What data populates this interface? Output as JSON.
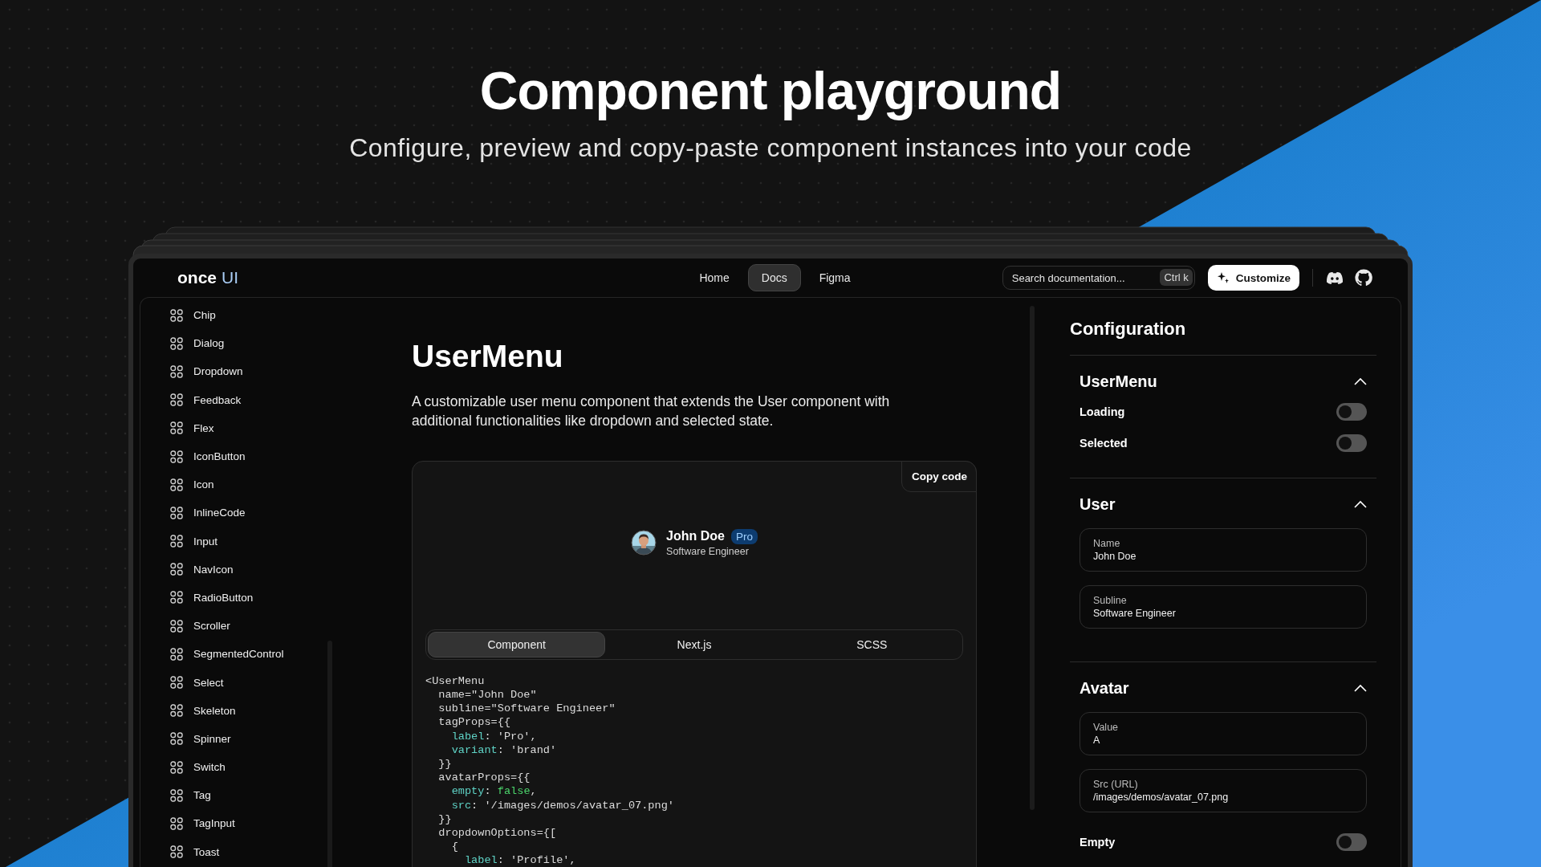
{
  "hero": {
    "title": "Component playground",
    "subtitle": "Configure, preview and copy-paste component instances into your code"
  },
  "header": {
    "logo": {
      "word": "once",
      "mark": "UI"
    },
    "nav": [
      {
        "label": "Home",
        "selected": false
      },
      {
        "label": "Docs",
        "selected": true
      },
      {
        "label": "Figma",
        "selected": false
      }
    ],
    "search": {
      "placeholder": "Search documentation...",
      "shortcut": "Ctrl k"
    },
    "customize_button": "Customize"
  },
  "sidebar": {
    "items": [
      "Chip",
      "Dialog",
      "Dropdown",
      "Feedback",
      "Flex",
      "IconButton",
      "Icon",
      "InlineCode",
      "Input",
      "NavIcon",
      "RadioButton",
      "Scroller",
      "SegmentedControl",
      "Select",
      "Skeleton",
      "Spinner",
      "Switch",
      "Tag",
      "TagInput",
      "Toast"
    ]
  },
  "page": {
    "title": "UserMenu",
    "description": "A customizable user menu component that extends the User component with additional functionalities like dropdown and selected state."
  },
  "preview": {
    "copy_button": "Copy code",
    "user": {
      "name": "John Doe",
      "tag": "Pro",
      "subline": "Software Engineer"
    },
    "tabs": [
      {
        "label": "Component",
        "selected": true
      },
      {
        "label": "Next.js",
        "selected": false
      },
      {
        "label": "SCSS",
        "selected": false
      }
    ],
    "code": [
      [
        {
          "kind": "plain",
          "text": "<UserMenu"
        }
      ],
      [
        {
          "kind": "plain",
          "text": "  name=\"John Doe\""
        }
      ],
      [
        {
          "kind": "plain",
          "text": "  subline=\"Software Engineer\""
        }
      ],
      [
        {
          "kind": "plain",
          "text": "  tagProps={{"
        }
      ],
      [
        {
          "kind": "key",
          "text": "    label"
        },
        {
          "kind": "plain",
          "text": ": 'Pro',"
        }
      ],
      [
        {
          "kind": "key",
          "text": "    variant"
        },
        {
          "kind": "plain",
          "text": ": 'brand'"
        }
      ],
      [
        {
          "kind": "plain",
          "text": "  }}"
        }
      ],
      [
        {
          "kind": "plain",
          "text": "  avatarProps={{"
        }
      ],
      [
        {
          "kind": "key",
          "text": "    empty"
        },
        {
          "kind": "plain",
          "text": ": "
        },
        {
          "kind": "bool",
          "text": "false"
        },
        {
          "kind": "plain",
          "text": ","
        }
      ],
      [
        {
          "kind": "key",
          "text": "    src"
        },
        {
          "kind": "plain",
          "text": ": '/images/demos/avatar_07.png'"
        }
      ],
      [
        {
          "kind": "plain",
          "text": "  }}"
        }
      ],
      [
        {
          "kind": "plain",
          "text": "  dropdownOptions={["
        }
      ],
      [
        {
          "kind": "plain",
          "text": "    {"
        }
      ],
      [
        {
          "kind": "key",
          "text": "      label"
        },
        {
          "kind": "plain",
          "text": ": 'Profile',"
        }
      ]
    ]
  },
  "configuration": {
    "title": "Configuration",
    "sections": [
      {
        "title": "UserMenu",
        "expanded": true,
        "controls": [
          {
            "kind": "switch",
            "label": "Loading",
            "on": false
          },
          {
            "kind": "switch",
            "label": "Selected",
            "on": false
          }
        ]
      },
      {
        "title": "User",
        "expanded": true,
        "controls": [
          {
            "kind": "field",
            "label": "Name",
            "value": "John Doe"
          },
          {
            "kind": "field",
            "label": "Subline",
            "value": "Software Engineer"
          }
        ]
      },
      {
        "title": "Avatar",
        "expanded": true,
        "controls": [
          {
            "kind": "field",
            "label": "Value",
            "value": "A"
          },
          {
            "kind": "field",
            "label": "Src (URL)",
            "value": "/images/demos/avatar_07.png"
          },
          {
            "kind": "switch",
            "label": "Empty",
            "on": false
          }
        ]
      }
    ]
  }
}
